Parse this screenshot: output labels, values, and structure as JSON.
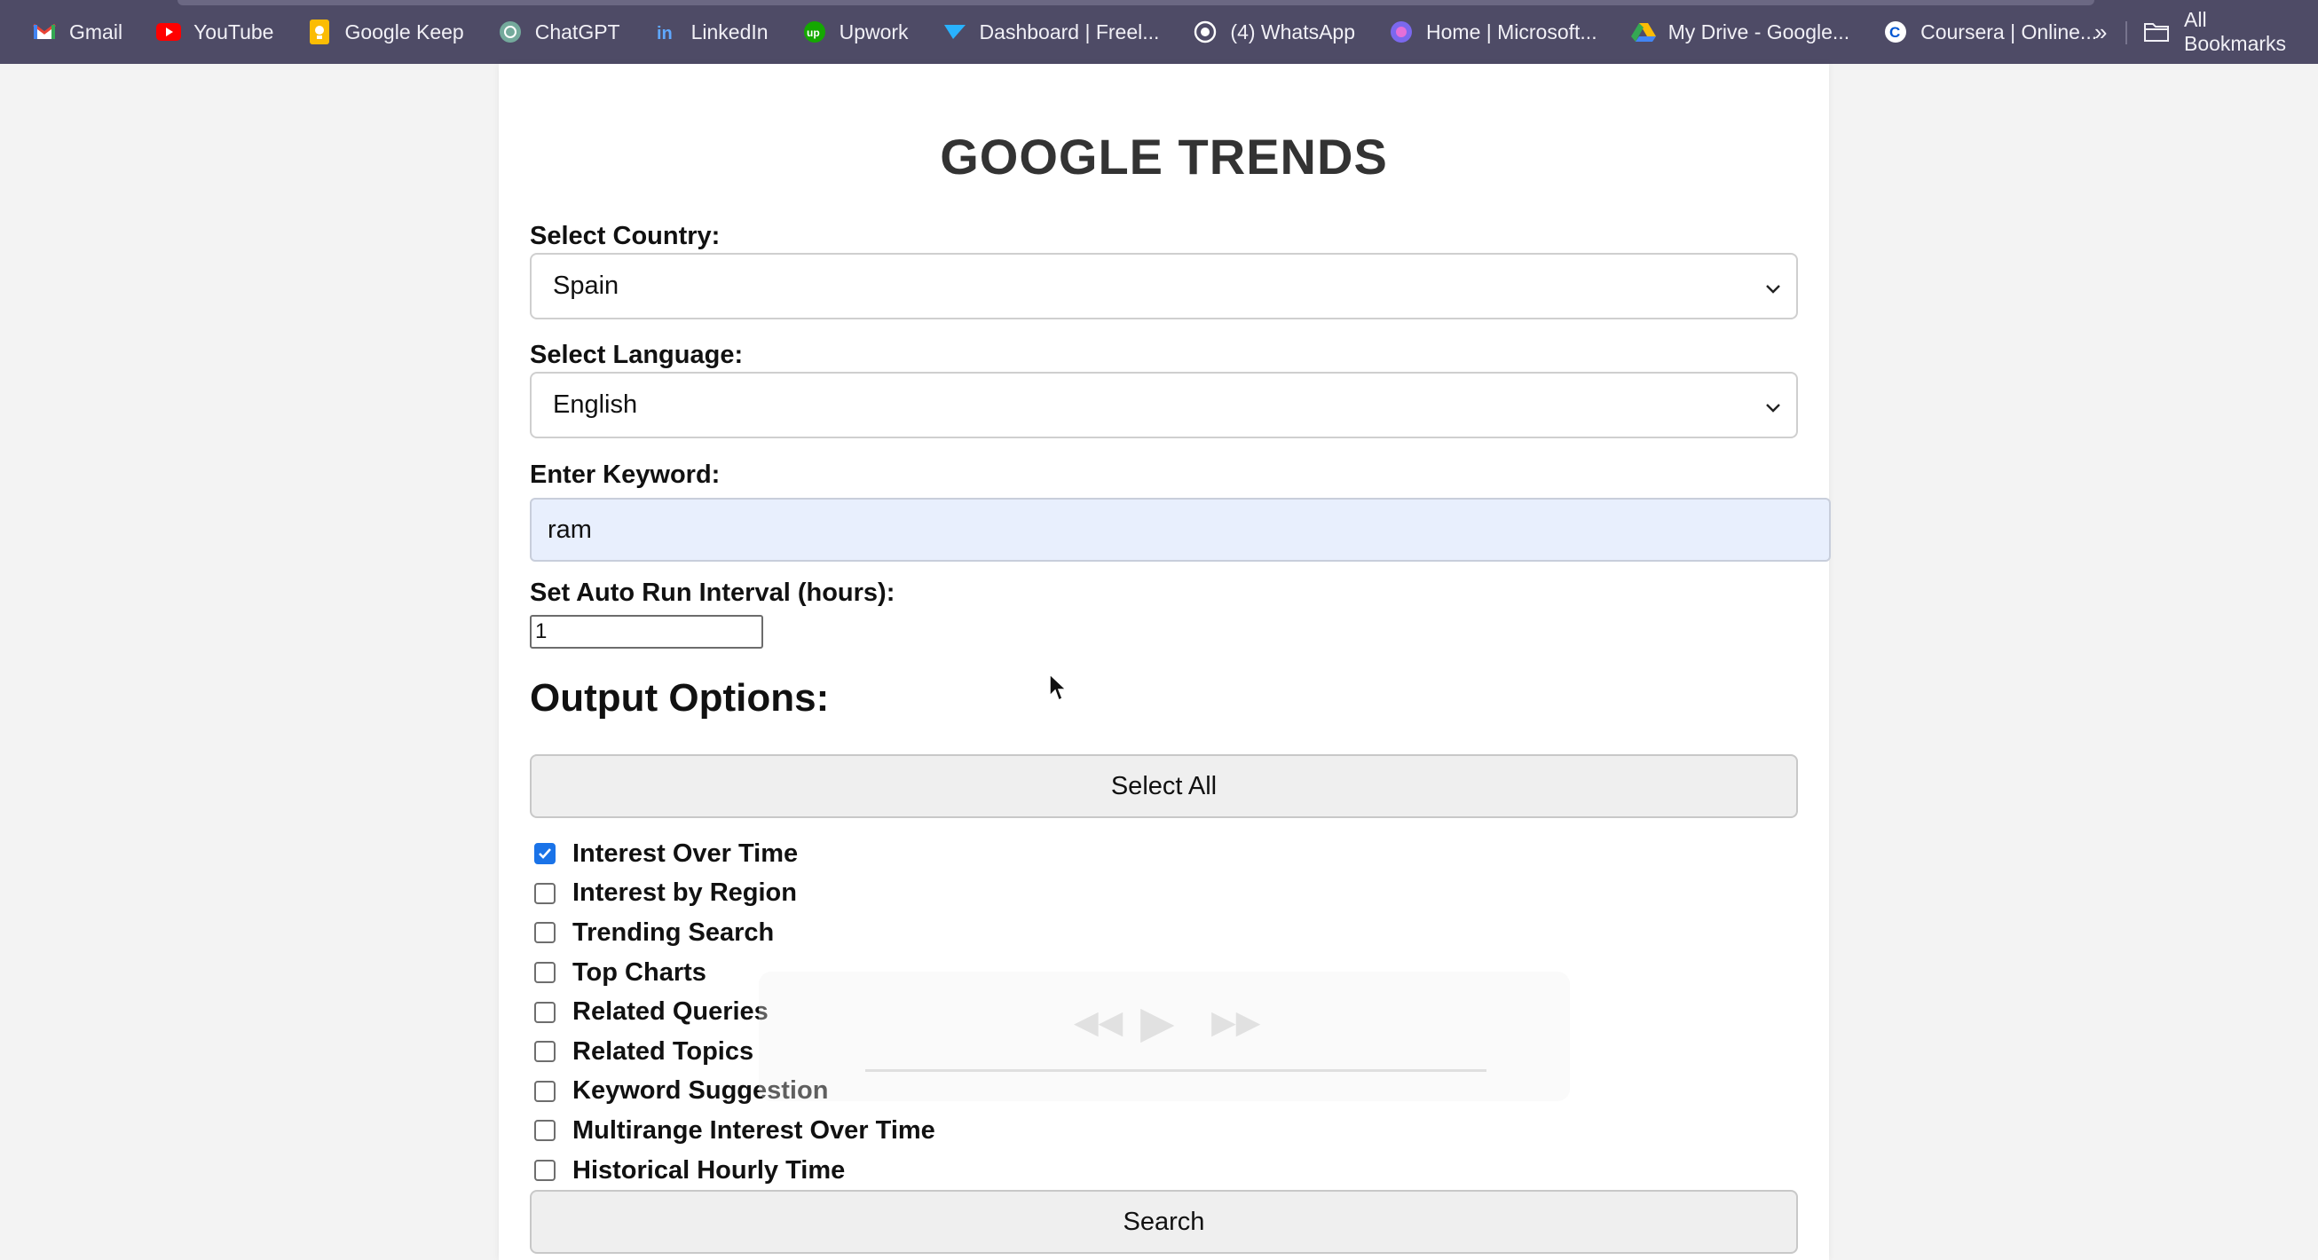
{
  "bookmarks": [
    {
      "label": "Gmail",
      "icon": "gmail-icon"
    },
    {
      "label": "YouTube",
      "icon": "youtube-icon"
    },
    {
      "label": "Google Keep",
      "icon": "google-keep-icon"
    },
    {
      "label": "ChatGPT",
      "icon": "chatgpt-icon"
    },
    {
      "label": "LinkedIn",
      "icon": "linkedin-icon"
    },
    {
      "label": "Upwork",
      "icon": "upwork-icon"
    },
    {
      "label": "Dashboard | Freel...",
      "icon": "freelancer-icon"
    },
    {
      "label": "(4) WhatsApp",
      "icon": "whatsapp-icon"
    },
    {
      "label": "Home | Microsoft...",
      "icon": "microsoft-icon"
    },
    {
      "label": "My Drive - Google...",
      "icon": "google-drive-icon"
    },
    {
      "label": "Coursera | Online...",
      "icon": "coursera-icon"
    }
  ],
  "bookmarks_more": "»",
  "all_bookmarks": "All Bookmarks",
  "page": {
    "title": "GOOGLE TRENDS",
    "country_label": "Select Country:",
    "country_value": "Spain",
    "language_label": "Select Language:",
    "language_value": "English",
    "keyword_label": "Enter Keyword:",
    "keyword_value": "ram",
    "interval_label": "Set Auto Run Interval (hours):",
    "interval_value": "1",
    "output_title": "Output Options:",
    "select_all_label": "Select All",
    "search_label": "Search"
  },
  "options": [
    {
      "label": "Interest Over Time",
      "checked": true
    },
    {
      "label": "Interest by Region",
      "checked": false
    },
    {
      "label": "Trending Search",
      "checked": false
    },
    {
      "label": "Top Charts",
      "checked": false
    },
    {
      "label": "Related Queries",
      "checked": false
    },
    {
      "label": "Related Topics",
      "checked": false
    },
    {
      "label": "Keyword Suggestion",
      "checked": false
    },
    {
      "label": "Multirange Interest Over Time",
      "checked": false
    },
    {
      "label": "Historical Hourly Time",
      "checked": false
    }
  ],
  "colors": {
    "bookmarks_bar": "#4e4b66",
    "checkbox_accent": "#1a73e8",
    "keyword_fill": "#e8effd"
  }
}
